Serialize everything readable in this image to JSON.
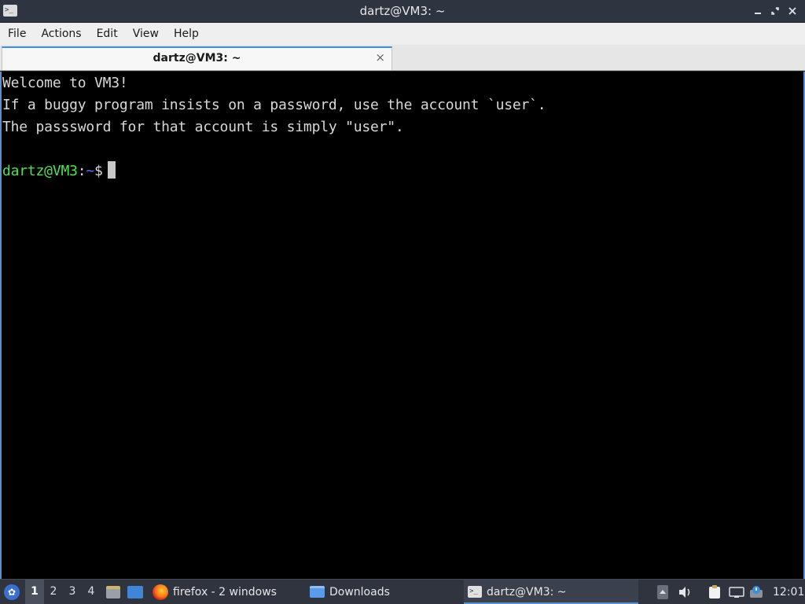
{
  "window": {
    "title": "dartz@VM3: ~",
    "icon": "terminal-icon"
  },
  "menu": {
    "items": [
      "File",
      "Actions",
      "Edit",
      "View",
      "Help"
    ]
  },
  "tab": {
    "label": "dartz@VM3: ~",
    "close": "×"
  },
  "terminal": {
    "lines": [
      "Welcome to VM3!",
      "If a buggy program insists on a password, use the account `user`.",
      "The passsword for that account is simply \"user\"."
    ],
    "prompt": {
      "user_host": "dartz@VM3",
      "colon": ":",
      "path": "~",
      "symbol": "$"
    }
  },
  "taskbar": {
    "workspaces": [
      "1",
      "2",
      "3",
      "4"
    ],
    "active_workspace": "1",
    "tasks": [
      {
        "label": "firefox - 2 windows",
        "icon": "firefox-icon"
      },
      {
        "label": "Downloads",
        "icon": "folder-icon"
      },
      {
        "label": "dartz@VM3: ~",
        "icon": "terminal-icon"
      }
    ],
    "clock": "12:01"
  },
  "colors": {
    "prompt_user": "#4fe24f",
    "prompt_path": "#5a6cff",
    "terminal_bg": "#000000",
    "accent": "#3b8ed8"
  }
}
